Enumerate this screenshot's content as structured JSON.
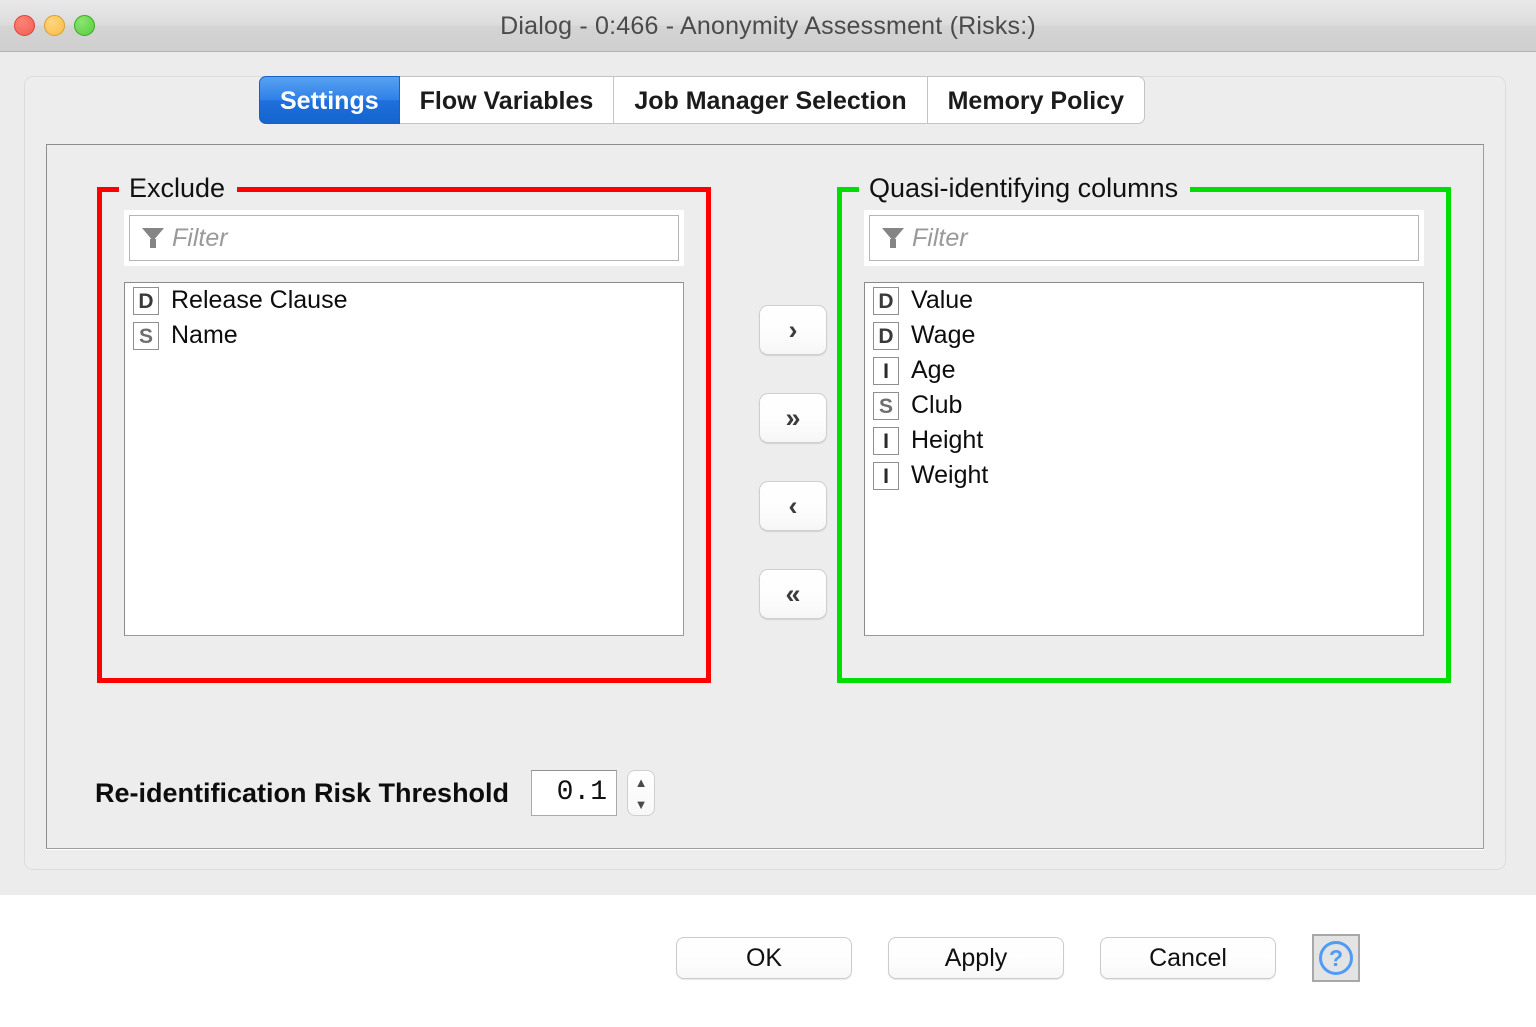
{
  "window": {
    "title": "Dialog - 0:466 - Anonymity Assessment (Risks:)",
    "traffic_lights": [
      "close",
      "minimize",
      "maximize"
    ]
  },
  "tabs": [
    {
      "label": "Settings",
      "active": true
    },
    {
      "label": "Flow Variables",
      "active": false
    },
    {
      "label": "Job Manager Selection",
      "active": false
    },
    {
      "label": "Memory Policy",
      "active": false
    }
  ],
  "panels": {
    "exclude": {
      "title": "Exclude",
      "border_color": "#ff0000",
      "filter_placeholder": "Filter",
      "filter_value": "",
      "items": [
        {
          "type": "D",
          "label": "Release Clause"
        },
        {
          "type": "S",
          "label": "Name"
        }
      ]
    },
    "include": {
      "title": "Quasi-identifying columns",
      "border_color": "#00dd00",
      "filter_placeholder": "Filter",
      "filter_value": "",
      "items": [
        {
          "type": "D",
          "label": "Value"
        },
        {
          "type": "D",
          "label": "Wage"
        },
        {
          "type": "I",
          "label": "Age"
        },
        {
          "type": "S",
          "label": "Club"
        },
        {
          "type": "I",
          "label": "Height"
        },
        {
          "type": "I",
          "label": "Weight"
        }
      ]
    }
  },
  "transfer_buttons": [
    {
      "name": "add-selected",
      "glyph": "›"
    },
    {
      "name": "add-all",
      "glyph": "»"
    },
    {
      "name": "remove-selected",
      "glyph": "‹"
    },
    {
      "name": "remove-all",
      "glyph": "«"
    }
  ],
  "threshold": {
    "label": "Re-identification Risk Threshold",
    "value": "0.1",
    "spinner_up": "▲",
    "spinner_down": "▼"
  },
  "actions": {
    "ok": "OK",
    "apply": "Apply",
    "cancel": "Cancel",
    "help": "?"
  },
  "colors": {
    "accent_tab": "#2f80e8",
    "exclude_highlight": "#ff0000",
    "include_highlight": "#00dd00",
    "help_icon": "#4f9bf5"
  }
}
